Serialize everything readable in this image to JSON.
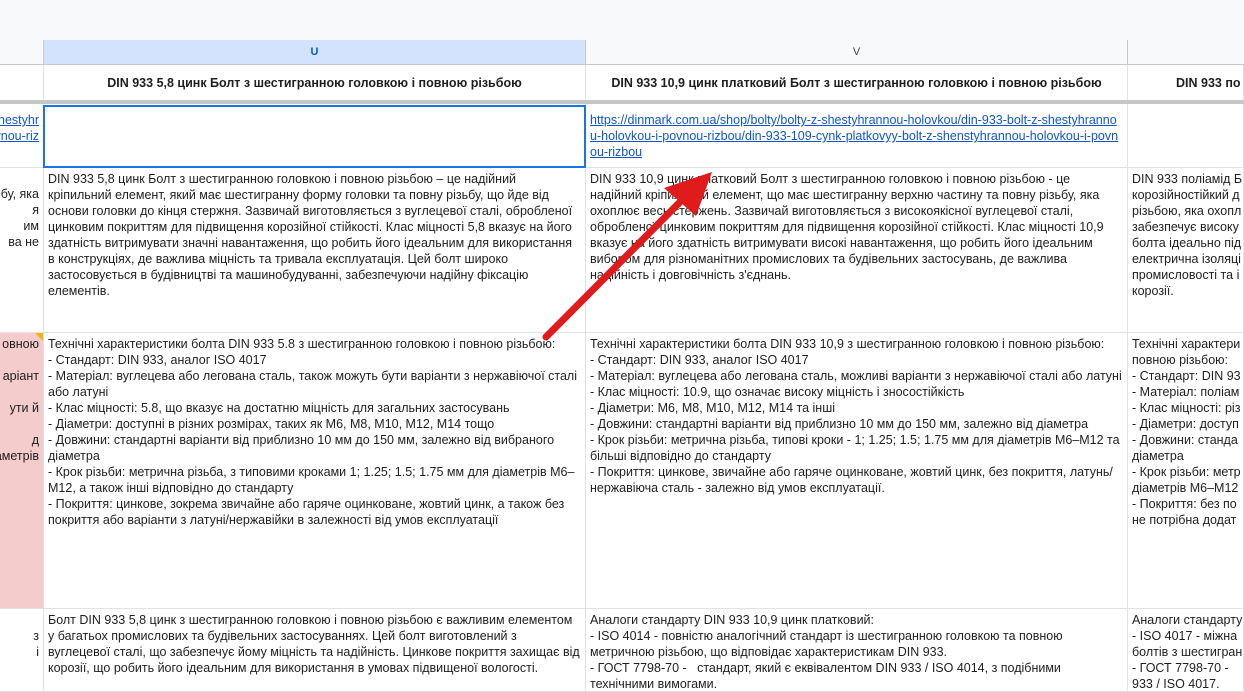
{
  "columns": {
    "u": "U",
    "v": "V"
  },
  "header_row": {
    "u": "DIN 933 5,8 цинк Болт з шестигранною головкою і повною різьбою",
    "v": "DIN 933 10,9 цинк платковий Болт з шестигранною головкою і повною різьбою",
    "w": "DIN 933 по"
  },
  "link_row": {
    "t": "shestyhr\nnou-holovkou-i-povnou-riz",
    "u": "",
    "v": "https://dinmark.com.ua/shop/bolty/bolty-z-shestyhrannou-holovkou/din-933-bolt-z-shestyhrannou-holovkou-i-povnou-rizbou/din-933-109-cynk-platkovyy-bolt-z-shenstyhrannou-holovkou-i-povnou-rizbou",
    "w": ""
  },
  "desc_row": {
    "t": "бу, яка\nя\nим\nва не",
    "u": "DIN 933 5,8 цинк Болт з шестигранною головкою і повною різьбою – це надійний кріпильний елемент, який має шестигранну форму головки та повну різьбу, що йде від основи головки до кінця стержня. Зазвичай виготовляється з вуглецевої сталі, обробленої цинковим покриттям для підвищення корозійної стійкості. Клас міцності 5,8 вказує на його здатність витримувати значні навантаження, що робить його ідеальним для використання в конструкціях, де важлива міцність та тривала експлуатація. Цей болт широко застосовується в будівництві та машинобудуванні, забезпечуючи надійну фіксацію елементів.",
    "v": "DIN 933 10,9 цинк платковий Болт з шестигранною головкою і повною різьбою - це надійний кріпильний елемент, що має шестигранну верхню частину та повну різьбу, яка охоплює весь стержень. Зазвичай виготовляється з високоякісної вуглецевої сталі, обробленої цинковим покриттям для підвищення корозійної стійкості. Клас міцності 10,9 вказує на його здатність витримувати високі навантаження, що робить його ідеальним вибором для різноманітних промислових та будівельних застосувань, де важлива надійність і довговічність з'єднань.",
    "w": "DIN 933 поліамід Б\nкорозійностійкий д\nрізьбою, яка охопл\nзабезпечує високу\nболта ідеально під\nелектрична ізоляці\nпромисловості та і\nкорозії."
  },
  "specs_row": {
    "t": "овною\n\nаріант\n\nути й\n\nд\nаметрів",
    "u": "Технічні характеристики болта DIN 933 5.8 з шестигранною головкою і повною різьбою:\n- Стандарт: DIN 933, аналог ISO 4017\n- Матеріал: вуглецева або легована сталь, також можуть бути варіанти з нержавіючої сталі або латуні\n- Клас міцності: 5.8, що вказує на достатню міцність для загальних застосувань\n- Діаметри: доступні в різних розмірах, таких як М6, М8, М10, М12, М14 тощо\n- Довжини: стандартні варіанти від приблизно 10 мм до 150 мм, залежно від вибраного діаметра\n- Крок різьби: метрична різьба, з типовими кроками 1; 1.25; 1.5; 1.75 мм для діаметрів М6–М12, а також інші відповідно до стандарту\n- Покриття: цинкове, зокрема звичайне або гаряче оцинковане, жовтий цинк, а також без покриття або варіанти з латуні/нержавійки в залежності від умов експлуатації",
    "v": "Технічні характеристики болта DIN 933 10,9 з шестигранною головкою і повною різьбою:\n- Стандарт: DIN 933, аналог ISO 4017\n- Матеріал: вуглецева або легована сталь, можливі варіанти з нержавіючої сталі або латуні\n- Клас міцності: 10.9, що означає високу міцність і зносостійкість\n- Діаметри: М6, М8, М10, М12, М14 та інші\n- Довжини: стандартні варіанти від приблизно 10 мм до 150 мм, залежно від діаметра\n- Крок різьби: метрична різьба, типові кроки - 1; 1.25; 1.5; 1.75 мм для діаметрів М6–М12 та більші відповідно до стандарту\n- Покриття: цинкове, звичайне або гаряче оцинковане, жовтий цинк, без покриття, латунь/нержавіюча сталь - залежно від умов експлуатації.",
    "w": "Технічні характери\nповною різьбою:\n- Стандарт: DIN 93\n- Матеріал: поліам\n- Клас міцності: різ\n- Діаметри: доступ\n- Довжини: станда\nдіаметра\n- Крок різьби: метр\nдіаметрів М6–М12\n- Покриття: без по\nне потрібна додат"
  },
  "usage_row": {
    "t": "\nз\nі",
    "u": "Болт DIN 933 5,8 цинк з шестигранною головкою і повною різьбою є важливим елементом у багатьох промислових та будівельних застосуваннях. Цей болт виготовлений з вуглецевої сталі, що забезпечує йому міцність та надійність. Цинкове покриття захищає від корозії, що робить його ідеальним для використання в умовах підвищеної вологості.",
    "v": "Аналоги стандарту DIN 933 10,9 цинк платковий:\n- ISO 4014 - повністю аналогічний стандарт із шестигранною головкою та повною метричною різьбою, що відповідає характеристикам DIN 933.\n- ГОСТ 7798-70 -   стандарт, який є еквівалентом DIN 933 / ISO 4014, з подібними технічними вимогами.",
    "w": "Аналоги стандарту\n- ISO 4017 - міжна\nболтів з шестигран\n- ГОСТ 7798-70 -  \n933 / ISO 4017."
  },
  "colors": {
    "selection": "#1a73e8",
    "selected_header": "#d3e3fd",
    "pink_cell": "#f4cccc",
    "arrow": "#e01b1b",
    "link": "#1155cc"
  }
}
